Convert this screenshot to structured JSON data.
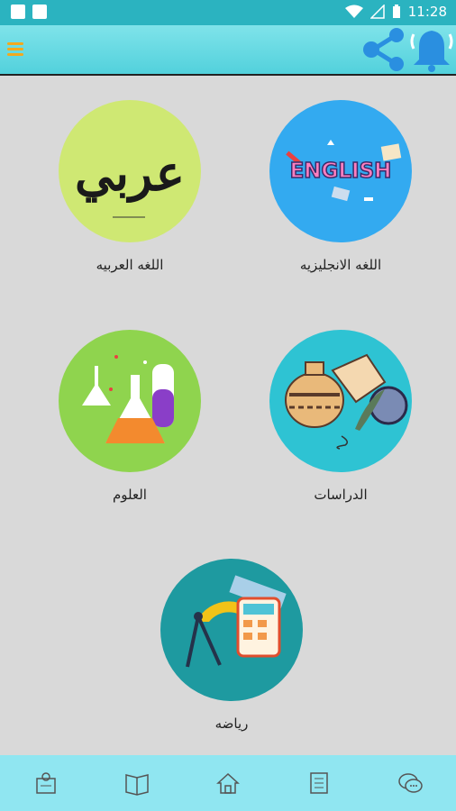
{
  "status": {
    "time": "11:28"
  },
  "subjects": [
    {
      "label": "اللغه الانجليزيه",
      "art_text": "ENGLISH"
    },
    {
      "label": "اللغه العربيه",
      "art_text": "عربي"
    },
    {
      "label": "الدراسات"
    },
    {
      "label": "العلوم"
    },
    {
      "label": "رياضه"
    }
  ],
  "colors": {
    "status_bar": "#2bb3c0",
    "app_bar": "#5fd6e0",
    "menu_accent": "#f2a91f",
    "bottom_nav": "#90e6f1"
  },
  "icons": {
    "menu": "hamburger-icon",
    "share": "share-icon",
    "notify": "bell-icon",
    "bottom_nav": [
      "school-icon",
      "book-icon",
      "home-icon",
      "notes-icon",
      "chat-icon"
    ]
  }
}
